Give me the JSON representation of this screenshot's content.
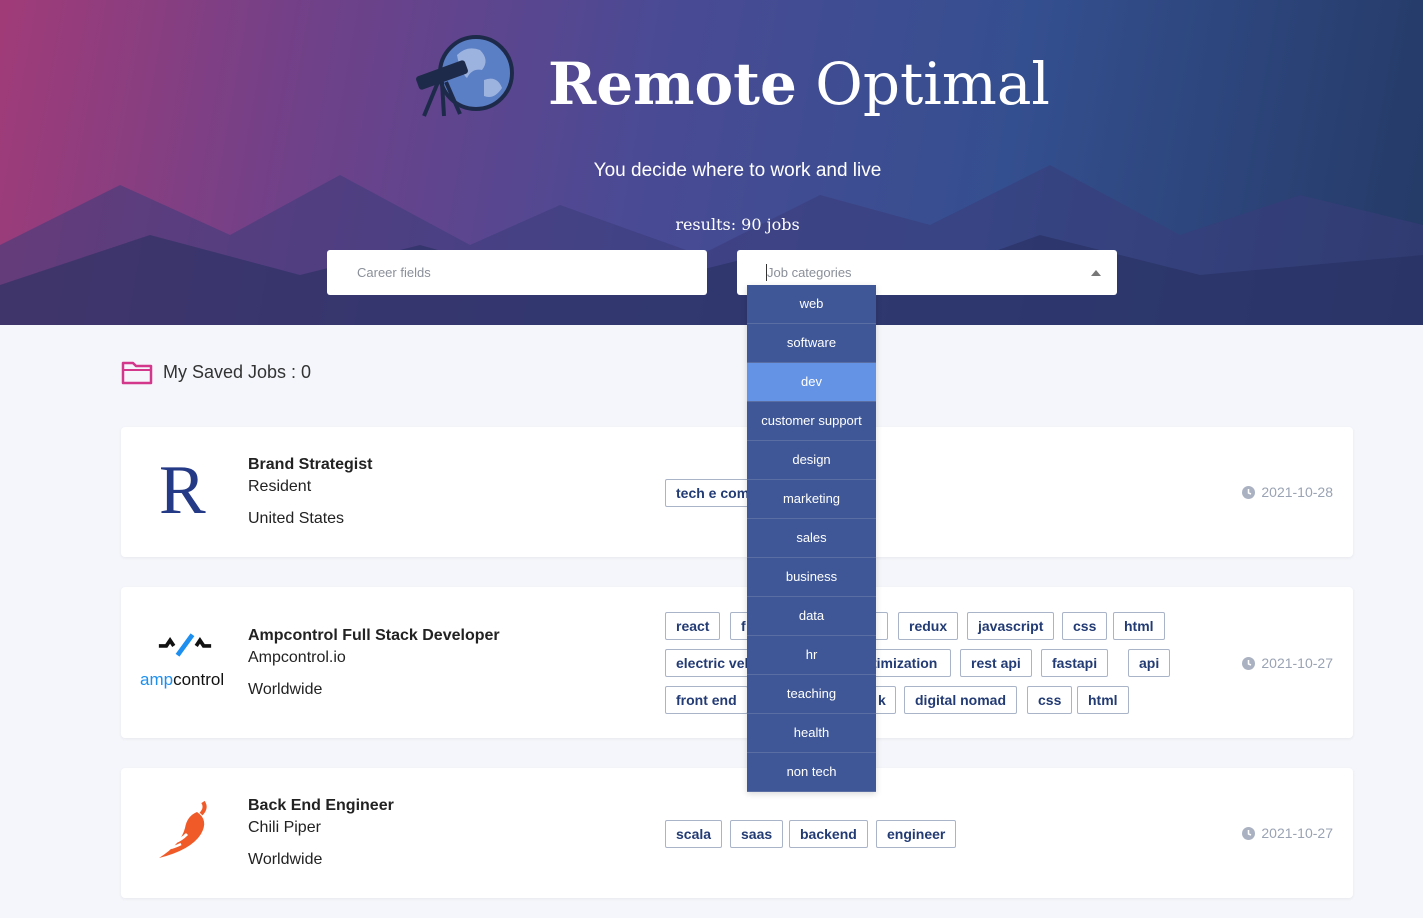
{
  "header": {
    "brand_bold": "Remote",
    "brand_light": "Optimal",
    "tagline": "You decide where to work and live",
    "results": "results: 90 jobs"
  },
  "filters": {
    "career_placeholder": "Career fields",
    "categories_placeholder": "Job categories"
  },
  "dropdown": {
    "options": [
      "web",
      "software",
      "dev",
      "customer support",
      "design",
      "marketing",
      "sales",
      "business",
      "data",
      "hr",
      "teaching",
      "health",
      "non tech"
    ],
    "active": "dev"
  },
  "saved": {
    "label": "My Saved Jobs : 0"
  },
  "jobs": [
    {
      "title": "Brand Strategist",
      "company": "Resident",
      "location": "United States",
      "date": "2021-10-28",
      "logo_letter": "R",
      "tags": [
        "tech e com"
      ]
    },
    {
      "title": "Ampcontrol Full Stack Developer",
      "company": "Ampcontrol.io",
      "location": "Worldwide",
      "date": "2021-10-27",
      "logo_text_a": "amp",
      "logo_text_b": "control",
      "tags_row1": [
        "react",
        "f",
        "a",
        "redux",
        "javascript",
        "css",
        "html"
      ],
      "tags_row2": [
        "electric vel",
        "timization",
        "rest api",
        "fastapi",
        "api"
      ],
      "tags_row3": [
        "front end",
        "k",
        "digital nomad",
        "css",
        "html"
      ]
    },
    {
      "title": "Back End Engineer",
      "company": "Chili Piper",
      "location": "Worldwide",
      "date": "2021-10-27",
      "tags": [
        "scala",
        "saas",
        "backend",
        "engineer"
      ]
    }
  ],
  "colors": {
    "dropdown_bg": "#3f5796",
    "dropdown_active": "#6493e6",
    "tag_text": "#233b74",
    "folder_icon": "#d3378c",
    "chili": "#f05a28"
  }
}
